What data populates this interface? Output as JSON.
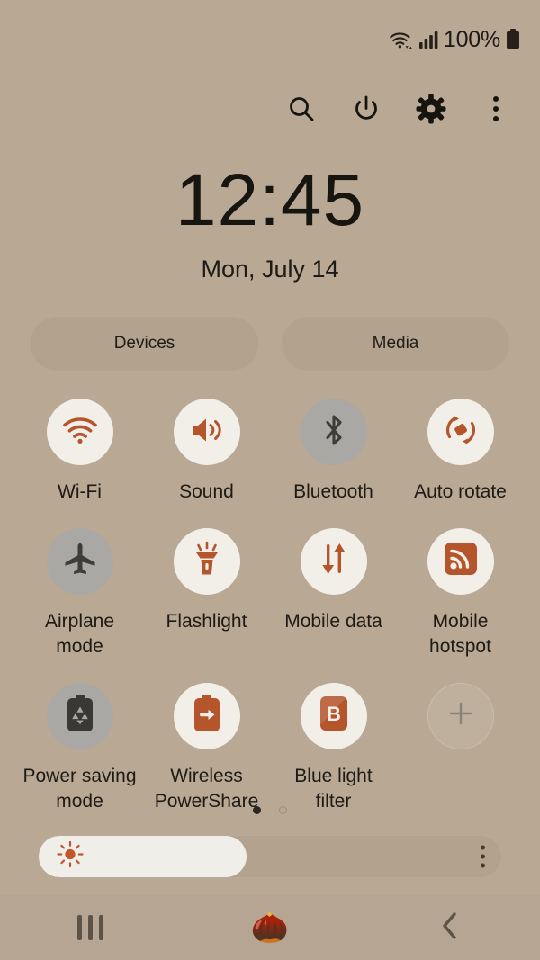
{
  "statusbar": {
    "wifi_icon": "wifi-with-transfer-icon",
    "signal_icon": "cellular-signal-icon",
    "battery_text": "100%",
    "battery_icon": "battery-full-icon"
  },
  "actionbar": {
    "items": [
      {
        "name": "search-icon",
        "label": "Search"
      },
      {
        "name": "power-icon",
        "label": "Power"
      },
      {
        "name": "settings-gear-icon",
        "label": "Settings"
      },
      {
        "name": "overflow-menu-icon",
        "label": "More options"
      }
    ]
  },
  "clock": {
    "time": "12:45",
    "date": "Mon, July 14"
  },
  "chips": [
    {
      "label": "Devices"
    },
    {
      "label": "Media"
    }
  ],
  "tiles": {
    "row1": [
      {
        "label": "Wi-Fi",
        "icon": "wifi-icon",
        "state": "on"
      },
      {
        "label": "Sound",
        "icon": "sound-speaker-icon",
        "state": "on"
      },
      {
        "label": "Bluetooth",
        "icon": "bluetooth-icon",
        "state": "off"
      },
      {
        "label": "Auto rotate",
        "icon": "auto-rotate-icon",
        "state": "on"
      }
    ],
    "row2": [
      {
        "label": "Airplane mode",
        "icon": "airplane-icon",
        "state": "off"
      },
      {
        "label": "Flashlight",
        "icon": "flashlight-icon",
        "state": "on"
      },
      {
        "label": "Mobile data",
        "icon": "mobile-data-arrows-icon",
        "state": "on"
      },
      {
        "label": "Mobile hotspot",
        "icon": "mobile-hotspot-icon",
        "state": "on"
      }
    ],
    "row3": [
      {
        "label": "Power saving mode",
        "icon": "power-saving-battery-icon",
        "state": "off"
      },
      {
        "label": "Wireless PowerShare",
        "icon": "wireless-powershare-icon",
        "state": "on"
      },
      {
        "label": "Blue light filter",
        "icon": "blue-light-filter-icon",
        "state": "on"
      },
      {
        "label": "",
        "icon": "add-tile-icon",
        "state": "add"
      }
    ]
  },
  "pager": {
    "total": 2,
    "active_index": 0
  },
  "brightness": {
    "value_percent": 45,
    "sun_icon": "brightness-sun-icon",
    "menu_icon": "brightness-options-icon"
  },
  "navbar": {
    "recents_label": "Recents",
    "home_icon": "acorn-home-icon",
    "home_glyph": "🌰",
    "back_label": "Back"
  },
  "colors": {
    "background": "#b9a894",
    "accent": "#b5552c",
    "tile_on_bg": "#f2efe9",
    "tile_off_bg": "#a9a8a4",
    "chip_bg": "#b2a28e",
    "text": "#1e1b15"
  }
}
